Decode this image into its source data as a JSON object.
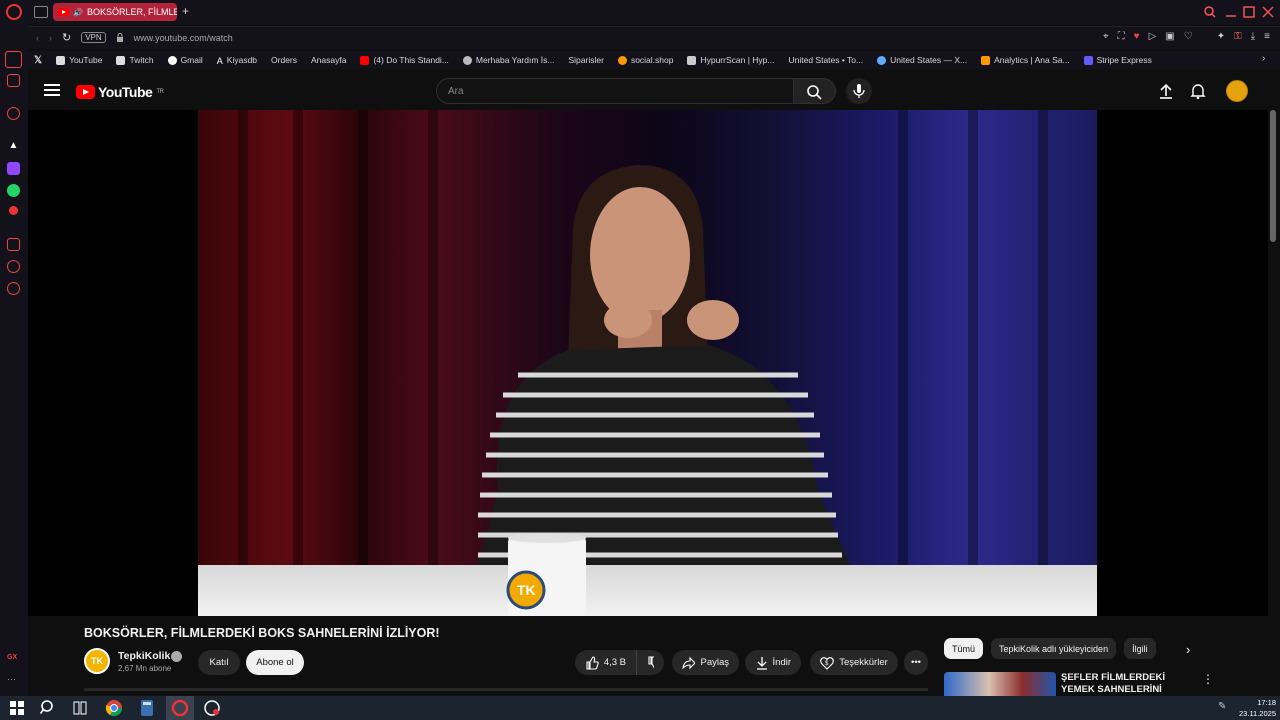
{
  "browser": {
    "tab_title": "BOKSÖRLER, FİLMLER",
    "new_tab": "+",
    "vpn_badge": "VPN",
    "url": "www.youtube.com/watch"
  },
  "bookmarks": [
    {
      "label": "YouTube"
    },
    {
      "label": "Twitch"
    },
    {
      "label": "Gmail"
    },
    {
      "label": "Kiyasdb"
    },
    {
      "label": "Orders"
    },
    {
      "label": "Anasayfa"
    },
    {
      "label": "(4) Do This Standi..."
    },
    {
      "label": "Merhaba Yardım İs..."
    },
    {
      "label": "Siparisler"
    },
    {
      "label": "social.shop"
    },
    {
      "label": "HypurrScan | Hyp..."
    },
    {
      "label": "United States • To..."
    },
    {
      "label": "United States — X..."
    },
    {
      "label": "Analytics | Ana Sa..."
    },
    {
      "label": "Stripe Express"
    }
  ],
  "youtube": {
    "logo_text": "YouTube",
    "logo_region": "TR",
    "search_placeholder": "Ara",
    "accent": "#ff0000"
  },
  "video": {
    "title": "BOKSÖRLER, FİLMLERDEKİ BOKS SAHNELERİNİ İZLİYOR!",
    "channel_name": "TepkiKolik",
    "channel_initials": "TK",
    "subscribers": "2,67 Mn abone",
    "join_label": "Katıl",
    "subscribe_label": "Abone ol",
    "likes": "4,3 B",
    "share_label": "Paylaş",
    "download_label": "İndir",
    "thanks_label": "Teşekkürler",
    "more_label": "•••"
  },
  "sidebar_chips": [
    "Tümü",
    "TepkiKolik adlı yükleyiciden",
    "İlgili"
  ],
  "recommended": {
    "title": "ŞEFLER FİLMLERDEKİ YEMEK SAHNELERİNİ İZLİYOR!"
  },
  "taskbar": {
    "time": "17:18",
    "date": "23.11.2025"
  }
}
